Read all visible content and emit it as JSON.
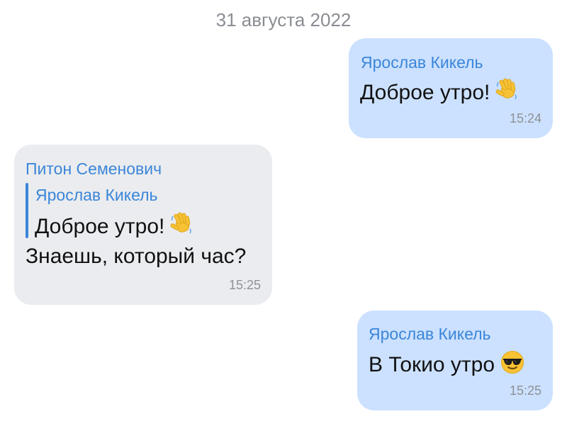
{
  "date_separator": "31 августа 2022",
  "messages": [
    {
      "direction": "outgoing",
      "sender": "Ярослав Кикель",
      "text": "Доброе утро!",
      "emoji": "waving-hand-icon",
      "time": "15:24"
    },
    {
      "direction": "incoming",
      "sender": "Питон Семенович",
      "reply": {
        "sender": "Ярослав Кикель",
        "text": "Доброе утро!",
        "emoji": "waving-hand-icon"
      },
      "text": "Знаешь, который час?",
      "time": "15:25"
    },
    {
      "direction": "outgoing",
      "sender": "Ярослав Кикель",
      "text": "В Токио утро",
      "emoji": "sunglasses-face-icon",
      "time": "15:25"
    }
  ],
  "colors": {
    "outgoing_bubble": "#cce1ff",
    "incoming_bubble": "#ebecef",
    "sender_name": "#3b86d9",
    "timestamp": "#8e9196",
    "date_separator": "#8a8d92",
    "reply_bar": "#3b86d9"
  }
}
